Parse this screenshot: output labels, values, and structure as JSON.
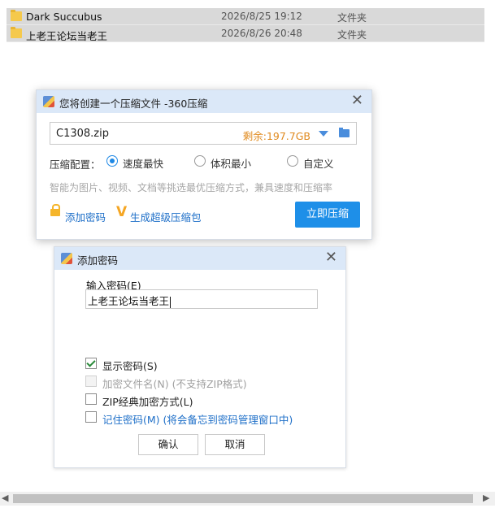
{
  "files": [
    {
      "name": "Dark Succubus",
      "date": "2026/8/25 19:12",
      "type": "文件夹"
    },
    {
      "name": "上老王论坛当老王",
      "date": "2026/8/26 20:48",
      "type": "文件夹"
    }
  ],
  "compress_dialog": {
    "title": "您将创建一个压缩文件 -360压缩",
    "filename": "C1308.zip",
    "remaining": "剩余:197.7GB",
    "config_label": "压缩配置：",
    "options": [
      {
        "label": "速度最快",
        "selected": true
      },
      {
        "label": "体积最小",
        "selected": false
      },
      {
        "label": "自定义",
        "selected": false
      }
    ],
    "hint": "智能为图片、视频、文档等挑选最优压缩方式，兼具速度和压缩率",
    "add_password": "添加密码",
    "super_pack": "生成超级压缩包",
    "compress_now": "立即压缩"
  },
  "password_dialog": {
    "title": "添加密码",
    "input_label": "输入密码(E)",
    "password_value": "上老王论坛当老王",
    "checkboxes": [
      {
        "label": "显示密码(S)",
        "checked": true,
        "disabled": false
      },
      {
        "label": "加密文件名(N)  (不支持ZIP格式)",
        "checked": false,
        "disabled": true
      },
      {
        "label": "ZIP经典加密方式(L)",
        "checked": false,
        "disabled": false
      },
      {
        "label": "记住密码(M) (将会备忘到密码管理窗口中)",
        "checked": false,
        "disabled": false
      }
    ],
    "ok": "确认",
    "cancel": "取消"
  },
  "scrollbar": {
    "left_arrow": "◀",
    "right_arrow": "▶"
  },
  "colors": {
    "accent": "#1e8fe8",
    "titlebar": "#dbe8f8",
    "remaining": "#e08a1e"
  }
}
